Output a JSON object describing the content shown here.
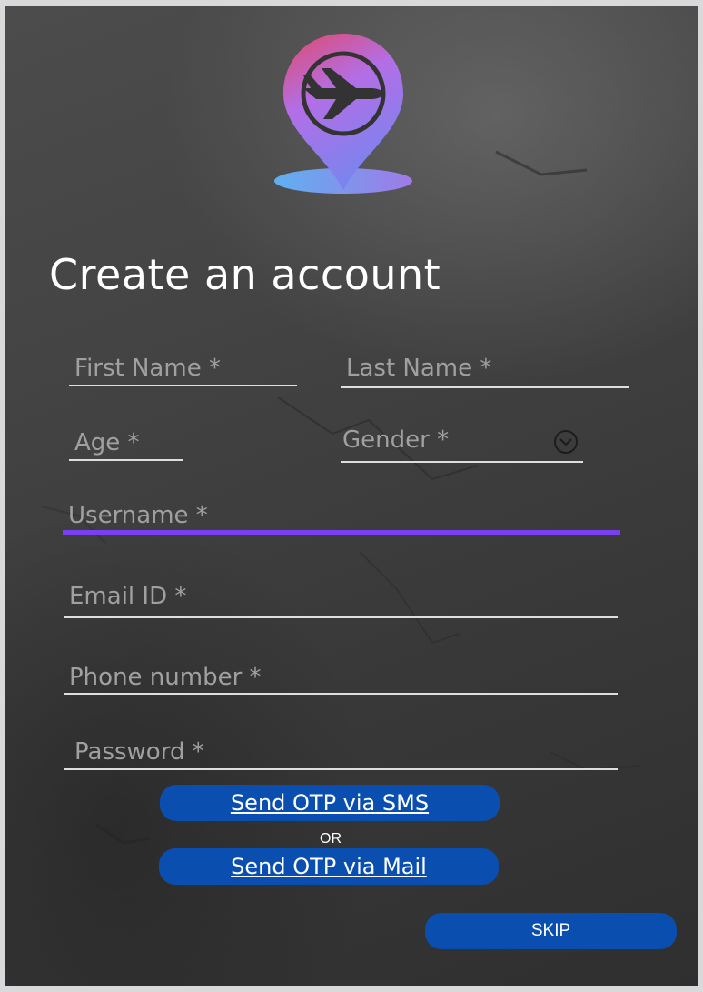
{
  "logo": {
    "icon": "airplane-location-pin-icon",
    "colors": {
      "top": "#e04a6b",
      "middle": "#b36ee6",
      "bottom": "#6aa8f0",
      "plane": "#333333"
    }
  },
  "title": "Create an account",
  "form": {
    "first_name": {
      "placeholder": "First Name *",
      "value": ""
    },
    "last_name": {
      "placeholder": "Last Name *",
      "value": ""
    },
    "age": {
      "placeholder": "Age *",
      "value": ""
    },
    "gender": {
      "placeholder": "Gender *",
      "icon": "chevron-down-circle-icon"
    },
    "username": {
      "placeholder": "Username *",
      "value": "",
      "focused": true
    },
    "email": {
      "placeholder": "Email ID *",
      "value": ""
    },
    "phone": {
      "placeholder": "Phone number *",
      "value": ""
    },
    "password": {
      "placeholder": "Password *",
      "value": ""
    }
  },
  "actions": {
    "send_sms": "Send OTP via SMS",
    "or": "OR",
    "send_mail": "Send OTP via Mail",
    "skip": "SKIP"
  },
  "colors": {
    "accent": "#7b3ff2",
    "button": "#0a4fb0",
    "background": "#3f3f3f",
    "field_line": "#dedede",
    "placeholder": "#a0a0a0"
  }
}
